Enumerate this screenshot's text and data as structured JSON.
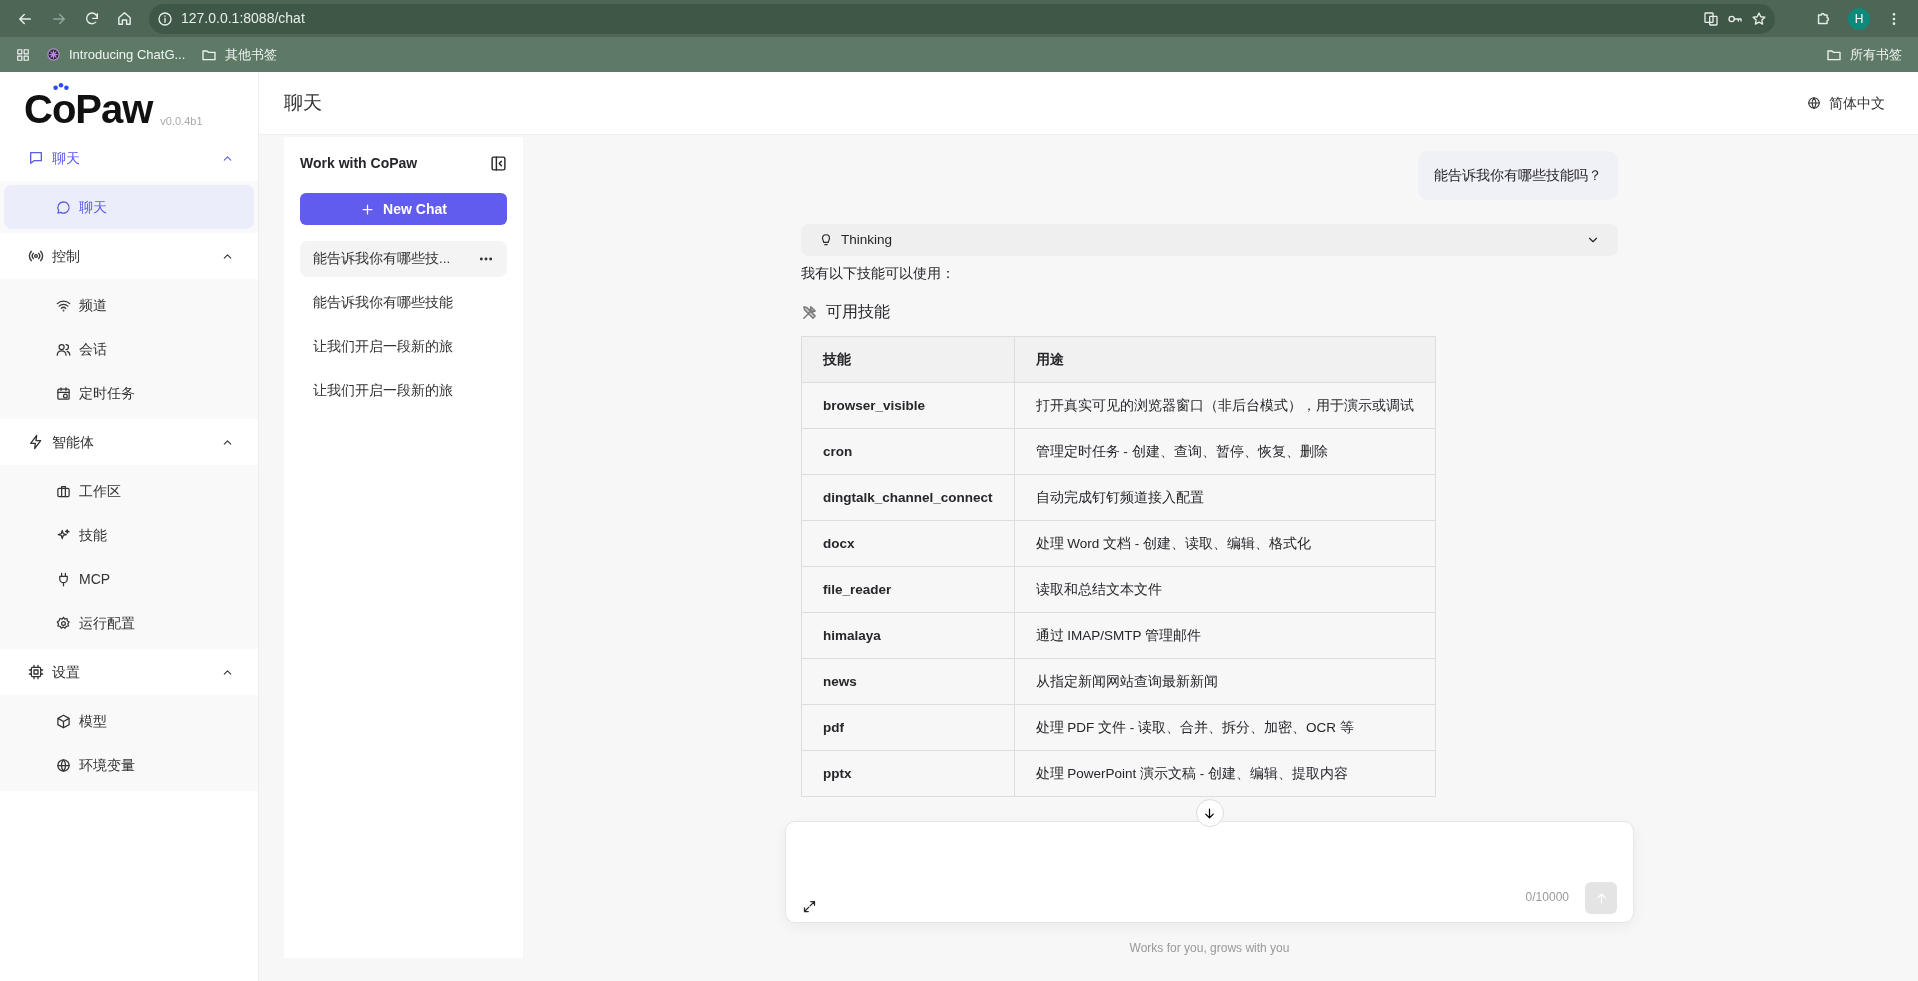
{
  "browser": {
    "url": "127.0.0.1:8088/chat",
    "forward_disabled": true,
    "profile_initial": "H",
    "bookmarks": [
      {
        "label": "Introducing ChatG...",
        "kind": "site"
      },
      {
        "label": "其他书签",
        "kind": "folder"
      }
    ],
    "all_bookmarks": "所有书签"
  },
  "app": {
    "logo": "CoPaw",
    "version": "v0.0.4b1"
  },
  "sidebar": {
    "groups": [
      {
        "label": "聊天",
        "selected": true,
        "expanded": true,
        "items": [
          {
            "label": "聊天",
            "selected": true
          }
        ]
      },
      {
        "label": "控制",
        "selected": false,
        "expanded": true,
        "items": [
          {
            "label": "频道",
            "selected": false
          },
          {
            "label": "会话",
            "selected": false
          },
          {
            "label": "定时任务",
            "selected": false
          }
        ]
      },
      {
        "label": "智能体",
        "selected": false,
        "expanded": true,
        "items": [
          {
            "label": "工作区",
            "selected": false
          },
          {
            "label": "技能",
            "selected": false
          },
          {
            "label": "MCP",
            "selected": false
          },
          {
            "label": "运行配置",
            "selected": false
          }
        ]
      },
      {
        "label": "设置",
        "selected": false,
        "expanded": true,
        "items": [
          {
            "label": "模型",
            "selected": false
          },
          {
            "label": "环境变量",
            "selected": false
          }
        ]
      }
    ]
  },
  "header": {
    "title": "聊天",
    "language": "简体中文"
  },
  "chat_list": {
    "title": "Work with CoPaw",
    "new_chat": "New Chat",
    "sessions": [
      {
        "title": "能告诉我你有哪些技...",
        "selected": true
      },
      {
        "title": "能告诉我你有哪些技能",
        "selected": false
      },
      {
        "title": "让我们开启一段新的旅",
        "selected": false
      },
      {
        "title": "让我们开启一段新的旅",
        "selected": false
      }
    ]
  },
  "conversation": {
    "user_message": "能告诉我你有哪些技能吗？",
    "thinking": {
      "label": "Thinking",
      "expanded": false
    },
    "intro": "我有以下技能可以使用：",
    "heading": "可用技能",
    "table": {
      "columns": [
        "技能",
        "用途"
      ],
      "rows": [
        [
          "browser_visible",
          "打开真实可见的浏览器窗口（非后台模式），用于演示或调试"
        ],
        [
          "cron",
          "管理定时任务 - 创建、查询、暂停、恢复、删除"
        ],
        [
          "dingtalk_channel_connect",
          "自动完成钉钉频道接入配置"
        ],
        [
          "docx",
          "处理 Word 文档 - 创建、读取、编辑、格式化"
        ],
        [
          "file_reader",
          "读取和总结文本文件"
        ],
        [
          "himalaya",
          "通过 IMAP/SMTP 管理邮件"
        ],
        [
          "news",
          "从指定新闻网站查询最新新闻"
        ],
        [
          "pdf",
          "处理 PDF 文件 - 读取、合并、拆分、加密、OCR 等"
        ],
        [
          "pptx",
          "处理 PowerPoint 演示文稿 - 创建、编辑、提取内容"
        ]
      ]
    }
  },
  "composer": {
    "counter": "0/10000",
    "send_disabled": true,
    "footer": "Works for you, grows with you"
  }
}
